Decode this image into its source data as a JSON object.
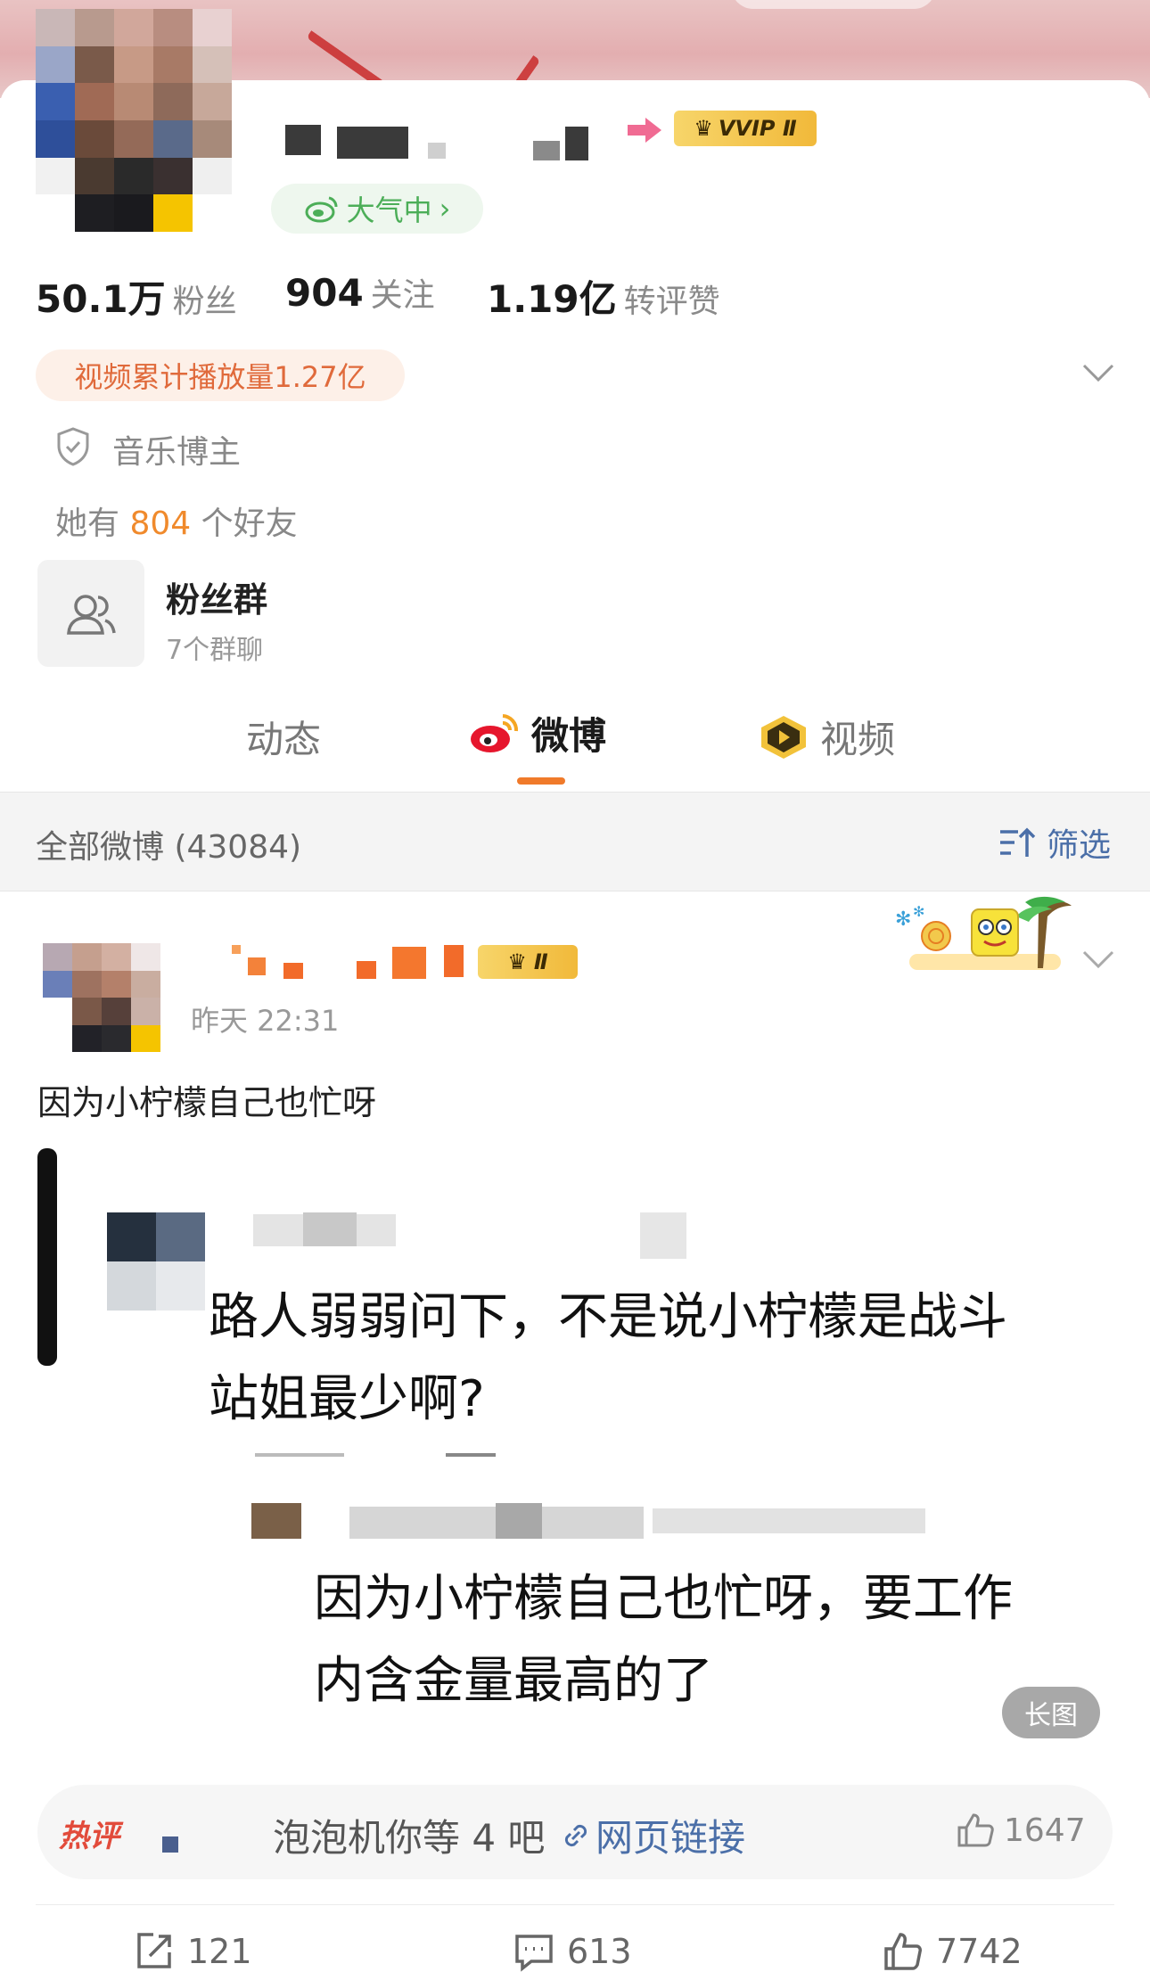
{
  "profile": {
    "vip_badge": "VVIP Ⅱ",
    "status_tag": "大气中",
    "status_chevron": "›",
    "stats": [
      {
        "value": "50.1万",
        "label": "粉丝"
      },
      {
        "value": "904",
        "label": "关注"
      },
      {
        "value": "1.19亿",
        "label": "转评赞"
      }
    ],
    "video_plays": "视频累计播放量1.27亿",
    "role": "音乐博主",
    "friends_prefix": "她有",
    "friends_count": "804",
    "friends_suffix": "个好友",
    "group": {
      "title": "粉丝群",
      "subtitle": "7个群聊"
    }
  },
  "tabs": [
    {
      "label": "动态"
    },
    {
      "label": "微博"
    },
    {
      "label": "视频"
    }
  ],
  "filter_bar": {
    "label": "全部微博 (43084)",
    "filter_label": "筛选"
  },
  "post": {
    "level_badge": "Ⅱ",
    "time": "昨天 22:31",
    "text": "因为小柠檬自己也忙呀",
    "quote_line1": "路人弱弱问下，不是说小柠檬是战斗",
    "quote_line2": "站姐最少啊?",
    "reply_line1": "因为小柠檬自己也忙呀，要工作",
    "reply_line2": "内含金量最高的了",
    "long_image_badge": "长图",
    "hot_comment": {
      "label": "热评",
      "text": "泡泡机你等 4 吧",
      "link": "网页链接",
      "likes": "1647"
    },
    "actions": {
      "reposts": "121",
      "comments": "613",
      "likes": "7742"
    }
  },
  "colors": {
    "accent_orange": "#f07a2a",
    "weibo_green": "#4cae58",
    "link_blue": "#4b6fa8",
    "hot_red": "#e24b3b"
  },
  "icons": [
    "weibo-logo-icon",
    "shield-icon",
    "group-icon",
    "chevron-down-icon",
    "filter-icon",
    "video-play-icon",
    "link-icon",
    "thumb-up-icon",
    "repost-icon",
    "comment-icon"
  ]
}
